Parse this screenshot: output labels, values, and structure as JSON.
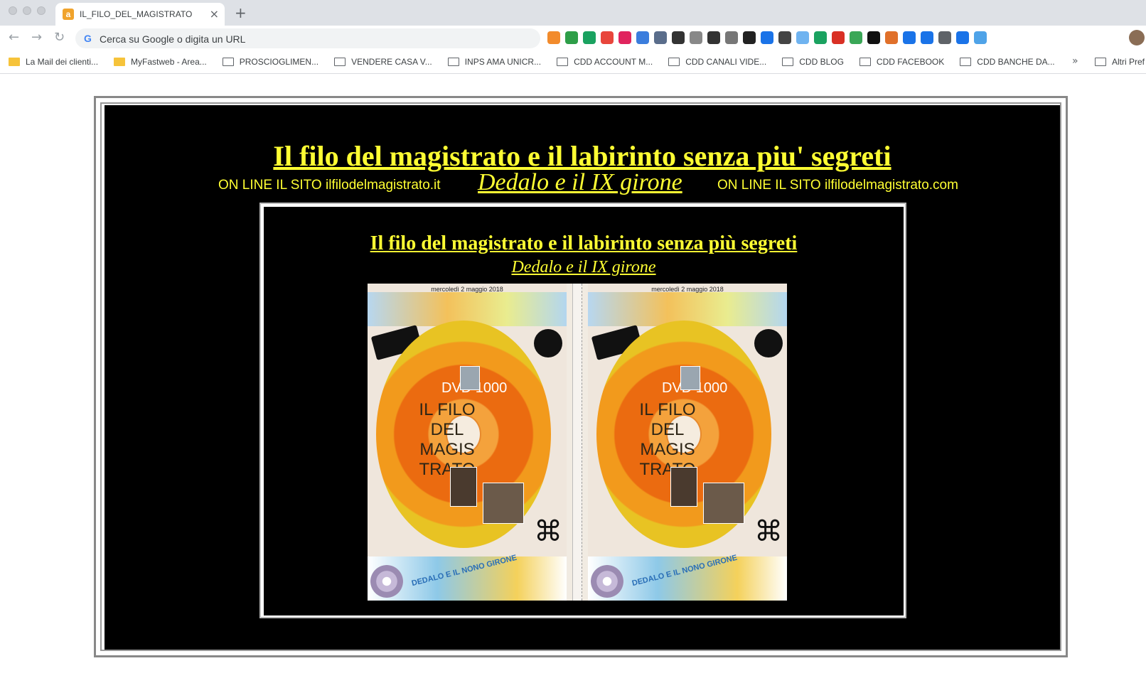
{
  "browser": {
    "tab_title": "IL_FILO_DEL_MAGISTRATO",
    "tab_favicon": "a",
    "tab_close": "×",
    "new_tab": "+",
    "omnibox_placeholder": "Cerca su Google o digita un URL",
    "back": "←",
    "forward": "→",
    "reload": "↻",
    "g_letter": "G",
    "bookmarks": [
      {
        "label": "La Mail dei clienti...",
        "icon": "mail-icon"
      },
      {
        "label": "MyFastweb - Area...",
        "icon": "mail-icon"
      },
      {
        "label": "PROSCIOGLIMEN...",
        "icon": "folder-icon"
      },
      {
        "label": "VENDERE CASA V...",
        "icon": "folder-icon"
      },
      {
        "label": "INPS AMA UNICR...",
        "icon": "folder-icon"
      },
      {
        "label": "CDD ACCOUNT M...",
        "icon": "folder-icon"
      },
      {
        "label": "CDD CANALI VIDE...",
        "icon": "folder-icon"
      },
      {
        "label": "CDD BLOG",
        "icon": "folder-icon"
      },
      {
        "label": "CDD FACEBOOK",
        "icon": "folder-icon"
      },
      {
        "label": "CDD BANCHE DA...",
        "icon": "folder-icon"
      }
    ],
    "bookmarks_more": "»",
    "other_bookmarks": "Altri Pref",
    "extension_colors": [
      "#f28b2c",
      "#2e9e48",
      "#1aa260",
      "#e8463c",
      "#e0245e",
      "#3b7ddd",
      "#5a6d8b",
      "#333333",
      "#888888",
      "#333333",
      "#777777",
      "#222222",
      "#1a73e8",
      "#444444",
      "#6fb3f0",
      "#1aa260",
      "#d93025",
      "#3aa757",
      "#111111",
      "#e0702a",
      "#1a73e8",
      "#1a73e8",
      "#5f6368",
      "#1a73e8",
      "#4fa3e8"
    ]
  },
  "page": {
    "title_main": "Il filo del magistrato e il labirinto senza piu' segreti",
    "online_left": "ON LINE IL SITO ilfilodelmagistrato.it",
    "subtitle_main": "Dedalo e il IX girone",
    "online_right": "ON LINE IL SITO ilfilodelmagistrato.com",
    "title_inner": "Il filo del magistrato e il labirinto senza più segreti",
    "subtitle_inner": "Dedalo e il IX girone",
    "covers": [
      {
        "date": "mercoledì 2 maggio 2018",
        "dvd": "DVD 1000",
        "disc_text": "IL FILO DEL MAGIS TRATO",
        "band": "DEDALO E IL NONO GIRONE"
      },
      {
        "date": "mercoledì 2 maggio 2018",
        "dvd": "DVD 1000",
        "disc_text": "IL FILO DEL MAGIS TRATO",
        "band": "DEDALO E IL NONO GIRONE"
      }
    ],
    "colors": {
      "accent_yellow": "#ffff33",
      "background": "#000000"
    }
  }
}
